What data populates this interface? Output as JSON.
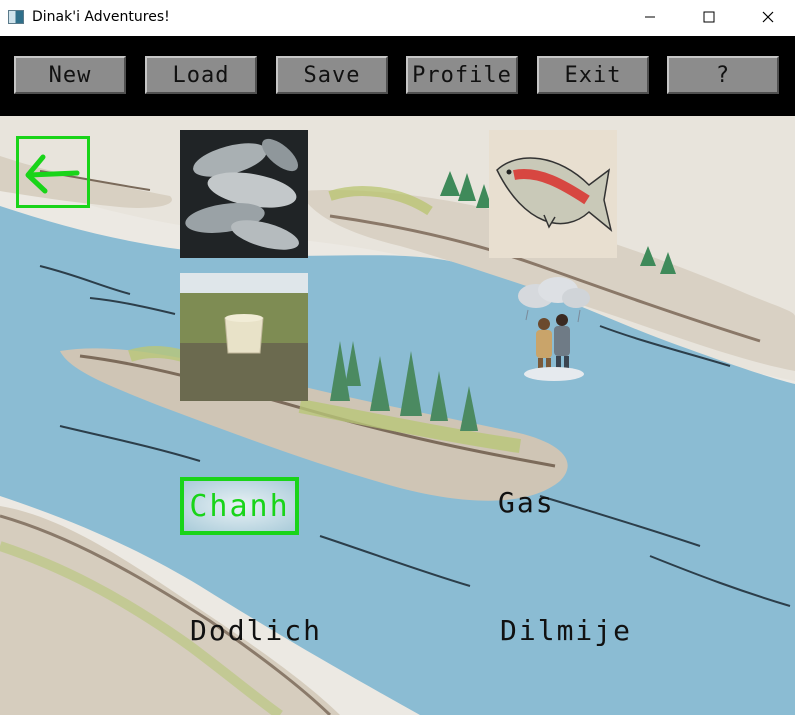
{
  "window": {
    "title": "Dinak'i Adventures!"
  },
  "toolbar": {
    "buttons": [
      {
        "id": "new",
        "label": "New"
      },
      {
        "id": "load",
        "label": "Load"
      },
      {
        "id": "save",
        "label": "Save"
      },
      {
        "id": "profile",
        "label": "Profile"
      },
      {
        "id": "exit",
        "label": "Exit"
      },
      {
        "id": "help",
        "label": "?"
      }
    ]
  },
  "map": {
    "words": {
      "chanh": "Chanh",
      "gas": "Gas",
      "dodlich": "Dodlich",
      "dilmije": "Dilmije"
    },
    "highlight_color": "#19d419"
  },
  "icons": {
    "back": "back-arrow-icon",
    "minimize": "minimize-icon",
    "maximize": "maximize-icon",
    "close": "close-icon"
  }
}
